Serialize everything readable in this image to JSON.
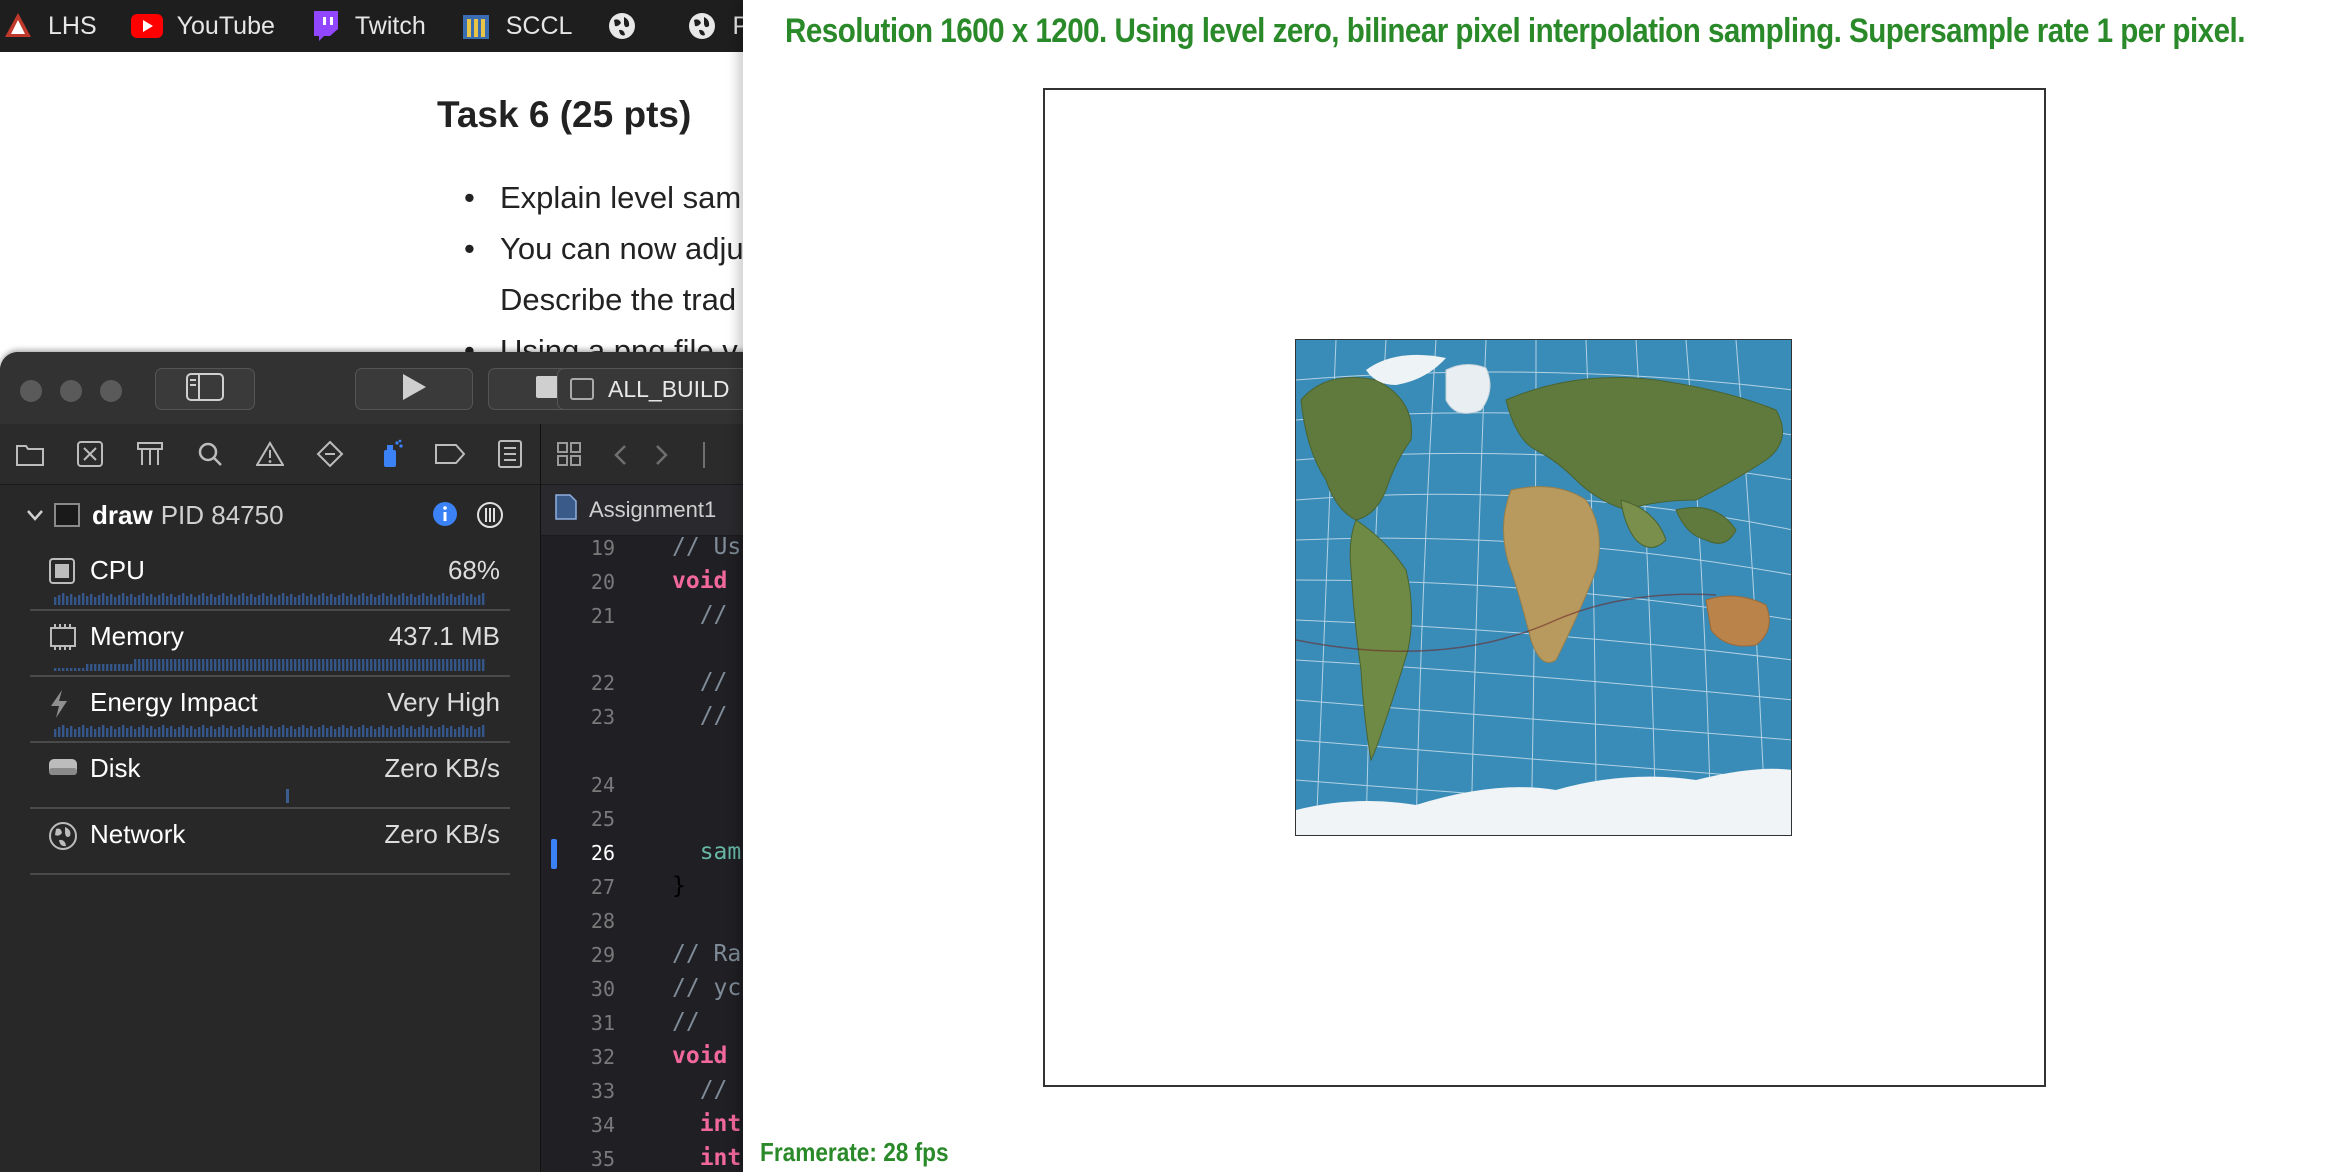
{
  "bookmarks": [
    {
      "label": "LHS",
      "icon": "lhs-icon"
    },
    {
      "label": "YouTube",
      "icon": "youtube-icon"
    },
    {
      "label": "Twitch",
      "icon": "twitch-icon"
    },
    {
      "label": "SCCL",
      "icon": "sccl-icon"
    },
    {
      "label": "",
      "icon": "globe-icon"
    },
    {
      "label": "Pa",
      "icon": "globe-icon"
    }
  ],
  "document": {
    "heading": "Task 6 (25 pts)",
    "bullets": [
      "Explain level sam",
      "You can now adju",
      "Describe the trad",
      "Using a png file v"
    ]
  },
  "xcode": {
    "scheme": "ALL_BUILD",
    "process": {
      "name": "draw",
      "pid": "PID 84750"
    },
    "gauges": [
      {
        "label": "CPU",
        "value": "68%",
        "icon": "cpu-icon"
      },
      {
        "label": "Memory",
        "value": "437.1 MB",
        "icon": "memory-chip-icon"
      },
      {
        "label": "Energy Impact",
        "value": "Very High",
        "icon": "lightning-icon"
      },
      {
        "label": "Disk",
        "value": "Zero KB/s",
        "icon": "disk-icon"
      },
      {
        "label": "Network",
        "value": "Zero KB/s",
        "icon": "network-globe-icon"
      }
    ],
    "editor": {
      "breadcrumb": "Assignment1",
      "lines": [
        {
          "n": "19",
          "text": "// Us",
          "cls": "cm"
        },
        {
          "n": "20",
          "text": "void",
          "cls": "kw"
        },
        {
          "n": "21",
          "text": "  //",
          "cls": "cm"
        },
        {
          "n": "22",
          "text": "  //",
          "cls": "cm"
        },
        {
          "n": "23",
          "text": "  //",
          "cls": "cm"
        },
        {
          "n": "24",
          "text": "",
          "cls": ""
        },
        {
          "n": "25",
          "text": "",
          "cls": ""
        },
        {
          "n": "26",
          "text": "  sam",
          "cls": "fn"
        },
        {
          "n": "27",
          "text": "}",
          "cls": ""
        },
        {
          "n": "28",
          "text": "",
          "cls": ""
        },
        {
          "n": "29",
          "text": "// Ra",
          "cls": "cm"
        },
        {
          "n": "30",
          "text": "// yc",
          "cls": "cm"
        },
        {
          "n": "31",
          "text": "//",
          "cls": "cm"
        },
        {
          "n": "32",
          "text": "void",
          "cls": "kw"
        },
        {
          "n": "33",
          "text": "  //",
          "cls": "cm"
        },
        {
          "n": "34",
          "text": "  int",
          "cls": "kw"
        },
        {
          "n": "35",
          "text": "  int",
          "cls": "kw"
        }
      ]
    }
  },
  "render": {
    "status": "Resolution 1600 x 1200. Using level zero, bilinear pixel interpolation sampling. Supersample rate 1 per pixel.",
    "framerate": "Framerate: 28 fps"
  },
  "colors": {
    "status_green": "#2a8a2a",
    "ocean": "#3a8cb8",
    "land": "#5f7a3c"
  }
}
